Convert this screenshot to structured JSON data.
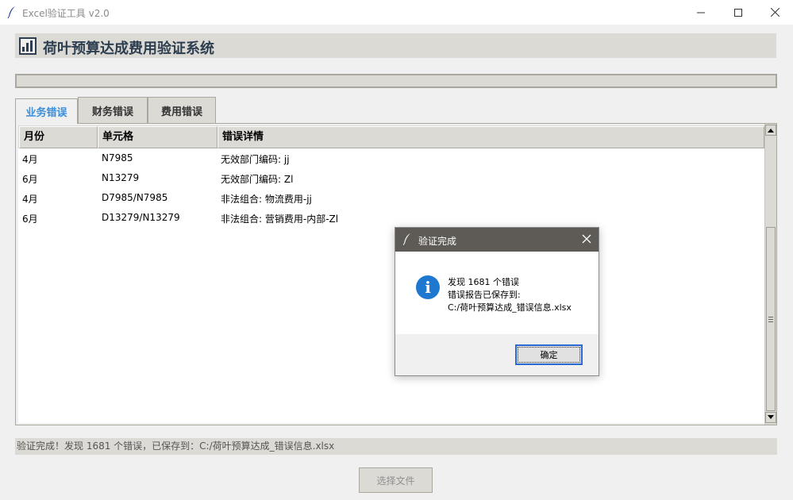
{
  "window": {
    "title": "Excel验证工具 v2.0"
  },
  "header": {
    "title": "荷叶预算达成费用验证系统",
    "icon": "bar-chart-icon"
  },
  "progress": {
    "value": 0
  },
  "tabs": [
    {
      "label": "业务错误",
      "active": true
    },
    {
      "label": "财务错误",
      "active": false
    },
    {
      "label": "费用错误",
      "active": false
    }
  ],
  "table": {
    "columns": [
      "月份",
      "单元格",
      "错误详情"
    ],
    "rows": [
      [
        "4月",
        "N7985",
        "无效部门编码: jj"
      ],
      [
        "6月",
        "N13279",
        "无效部门编码: Zl"
      ],
      [
        "4月",
        "D7985/N7985",
        "非法组合: 物流费用-jj"
      ],
      [
        "6月",
        "D13279/N13279",
        "非法组合: 营销费用-内部-Zl"
      ]
    ]
  },
  "status": {
    "text": "验证完成！发现 1681 个错误，已保存到：C:/荷叶预算达成_错误信息.xlsx"
  },
  "select_button": {
    "label": "选择文件"
  },
  "dialog": {
    "title": "验证完成",
    "line1": "发现 1681 个错误",
    "line2": "错误报告已保存到:",
    "line3": "C:/荷叶预算达成_错误信息.xlsx",
    "ok_label": "确定",
    "icon": "info-icon",
    "icon_glyph": "i"
  },
  "colors": {
    "accent": "#3a8fd8",
    "title_text": "#2c3e50",
    "dialog_titlebar": "#5e5a55",
    "info_icon": "#1e78d0"
  }
}
